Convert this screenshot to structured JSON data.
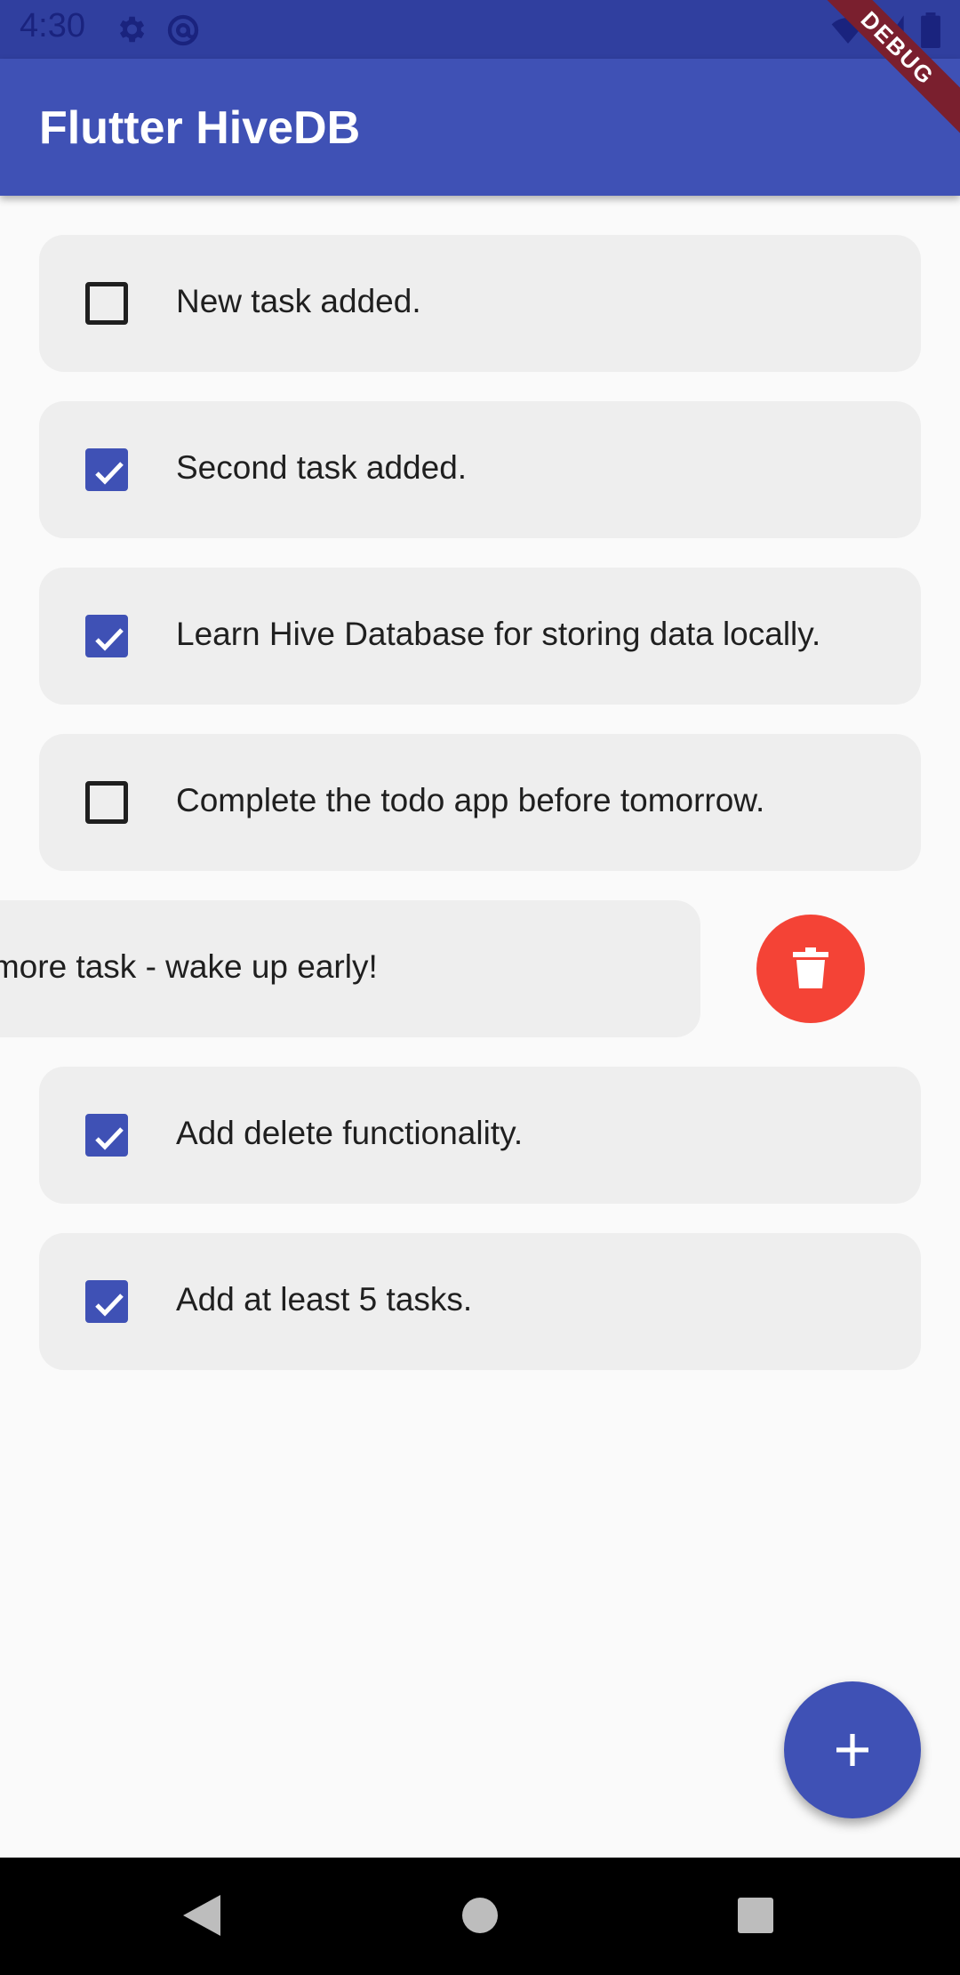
{
  "status_bar": {
    "time": "4:30",
    "icons": [
      "settings-icon",
      "at-sign-icon",
      "wifi-icon",
      "signal-icon",
      "battery-icon"
    ]
  },
  "app_bar": {
    "title": "Flutter HiveDB",
    "debug_label": "DEBUG",
    "color": "#3f51b5"
  },
  "tasks": [
    {
      "text": "New task added.",
      "checked": false
    },
    {
      "text": "Second task added.",
      "checked": true
    },
    {
      "text": "Learn Hive Database for storing data locally.",
      "checked": true
    },
    {
      "text": "Complete the todo app before tomorrow.",
      "checked": false
    },
    {
      "text": "e more task - wake up early!",
      "checked": null,
      "swiped": true
    },
    {
      "text": "Add delete functionality.",
      "checked": true
    },
    {
      "text": "Add at least 5 tasks.",
      "checked": true
    }
  ],
  "delete_action": {
    "icon": "trash-icon",
    "color": "#f44336"
  },
  "fab": {
    "icon": "plus-icon",
    "color": "#3f51b5"
  },
  "nav_bar": {
    "buttons": [
      "back-icon",
      "home-icon",
      "recents-icon"
    ]
  }
}
